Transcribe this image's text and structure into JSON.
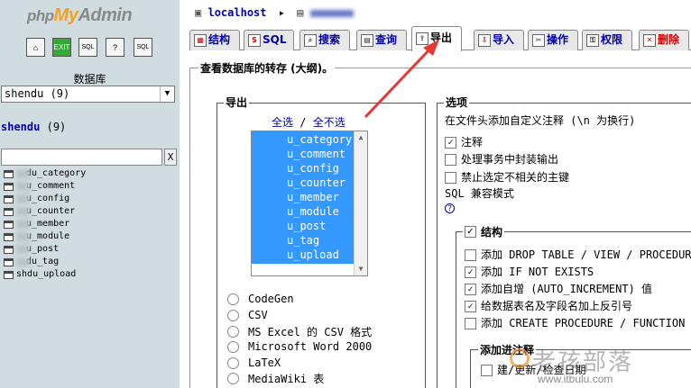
{
  "sidebar": {
    "logo": {
      "php": "php",
      "my": "My",
      "admin": "Admin"
    },
    "db_label": "数据库",
    "db_select": "shendu (9)",
    "db_name": "shendu",
    "db_count": "(9)",
    "filter_clear": "X",
    "tables": [
      {
        "prefix": "",
        "name": "du_category"
      },
      {
        "prefix": "",
        "name": "u_comment"
      },
      {
        "prefix": "",
        "name": "u_config"
      },
      {
        "prefix": "",
        "name": "u_counter"
      },
      {
        "prefix": "",
        "name": "u_member"
      },
      {
        "prefix": "",
        "name": "u_module"
      },
      {
        "prefix": "",
        "name": "u_post"
      },
      {
        "prefix": "",
        "name": "du_tag"
      },
      {
        "prefix": "sh",
        "name": "du_upload"
      }
    ]
  },
  "breadcrumb": {
    "server": "localhost"
  },
  "tabs": [
    {
      "label": "结构",
      "icon": "structure-icon"
    },
    {
      "label": "SQL",
      "icon": "sql-icon"
    },
    {
      "label": "搜索",
      "icon": "search-icon"
    },
    {
      "label": "查询",
      "icon": "query-icon"
    },
    {
      "label": "导出",
      "icon": "export-icon"
    },
    {
      "label": "导入",
      "icon": "import-icon"
    },
    {
      "label": "操作",
      "icon": "operations-icon"
    },
    {
      "label": "权限",
      "icon": "privileges-icon"
    },
    {
      "label": "删除",
      "icon": "drop-icon"
    }
  ],
  "export": {
    "title": "查看数据库的转存 (大纲)。",
    "export_legend": "导出",
    "select_all": "全选",
    "slash": "/",
    "deselect_all": "全不选",
    "table_items": [
      "u_category",
      "u_comment",
      "u_config",
      "u_counter",
      "u_member",
      "u_module",
      "u_post",
      "u_tag",
      "u_upload"
    ],
    "formats": [
      "CodeGen",
      "CSV",
      "MS Excel 的 CSV 格式",
      "Microsoft Word 2000",
      "LaTeX",
      "MediaWiki 表"
    ]
  },
  "options": {
    "legend": "选项",
    "header_comment": "在文件头添加自定义注释 (\\n 为换行)",
    "comments": {
      "label": "注释",
      "checked": true
    },
    "transaction": {
      "label": "处理事务中封装输出",
      "checked": false
    },
    "disable_fk": {
      "label": "禁止选定不相关的主键",
      "checked": false
    },
    "sql_compat": "SQL 兼容模式",
    "structure": {
      "legend": "结构",
      "checked": true,
      "items": [
        {
          "label": "添加 DROP TABLE / VIEW / PROCEDURE",
          "checked": false
        },
        {
          "label": "添加 IF NOT EXISTS",
          "checked": true
        },
        {
          "label": "添加自增 (AUTO_INCREMENT) 值",
          "checked": true
        },
        {
          "label": "给数据表名及字段名加上反引号",
          "checked": true
        },
        {
          "label": "添加 CREATE PROCEDURE / FUNCTION /",
          "checked": false
        }
      ],
      "comments_legend": "添加进注释",
      "comments_item": "建/更新/检查日期"
    }
  },
  "watermark": {
    "cn": "老孩部落",
    "url": "www.itbulu.com"
  },
  "colors": {
    "sidebar_bg": "#d0dce0",
    "selection": "#3399ff",
    "arrow": "#e53935",
    "link": "#0000aa"
  }
}
